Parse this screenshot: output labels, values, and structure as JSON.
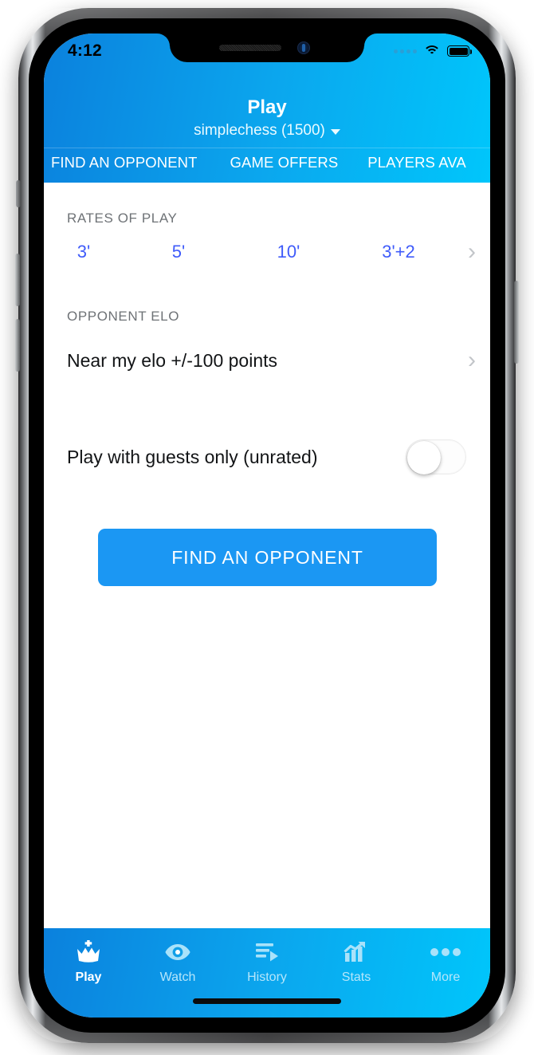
{
  "status_bar": {
    "time": "4:12",
    "signal_icon": "signal-dots-icon",
    "wifi_icon": "wifi-icon",
    "battery_icon": "battery-full-icon"
  },
  "header": {
    "title": "Play",
    "subtitle": "simplechess (1500)",
    "subtitle_caret_icon": "chevron-down-icon",
    "gradient_from": "#0b81dd",
    "gradient_to": "#00c6fb"
  },
  "tabs": [
    {
      "label": "FIND AN OPPONENT",
      "active": true
    },
    {
      "label": "GAME OFFERS",
      "active": false
    },
    {
      "label": "PLAYERS AVA",
      "active": false
    }
  ],
  "main": {
    "rates_of_play": {
      "label": "RATES OF PLAY",
      "options": [
        "3'",
        "5'",
        "10'",
        "3'+2"
      ],
      "more_icon": "chevron-right-icon",
      "accent_color": "#3f5bfa"
    },
    "opponent_elo": {
      "label": "OPPONENT ELO",
      "value": "Near my elo +/-100 points",
      "more_icon": "chevron-right-icon"
    },
    "guests_toggle": {
      "label": "Play with guests only (unrated)",
      "state": "off"
    },
    "primary_button": {
      "label": "FIND AN OPPONENT",
      "color": "#1b97f3"
    }
  },
  "bottom_nav": [
    {
      "label": "Play",
      "icon": "crown-icon",
      "active": true
    },
    {
      "label": "Watch",
      "icon": "eye-icon",
      "active": false
    },
    {
      "label": "History",
      "icon": "playlist-icon",
      "active": false
    },
    {
      "label": "Stats",
      "icon": "bar-chart-icon",
      "active": false
    },
    {
      "label": "More",
      "icon": "ellipsis-icon",
      "active": false
    }
  ]
}
